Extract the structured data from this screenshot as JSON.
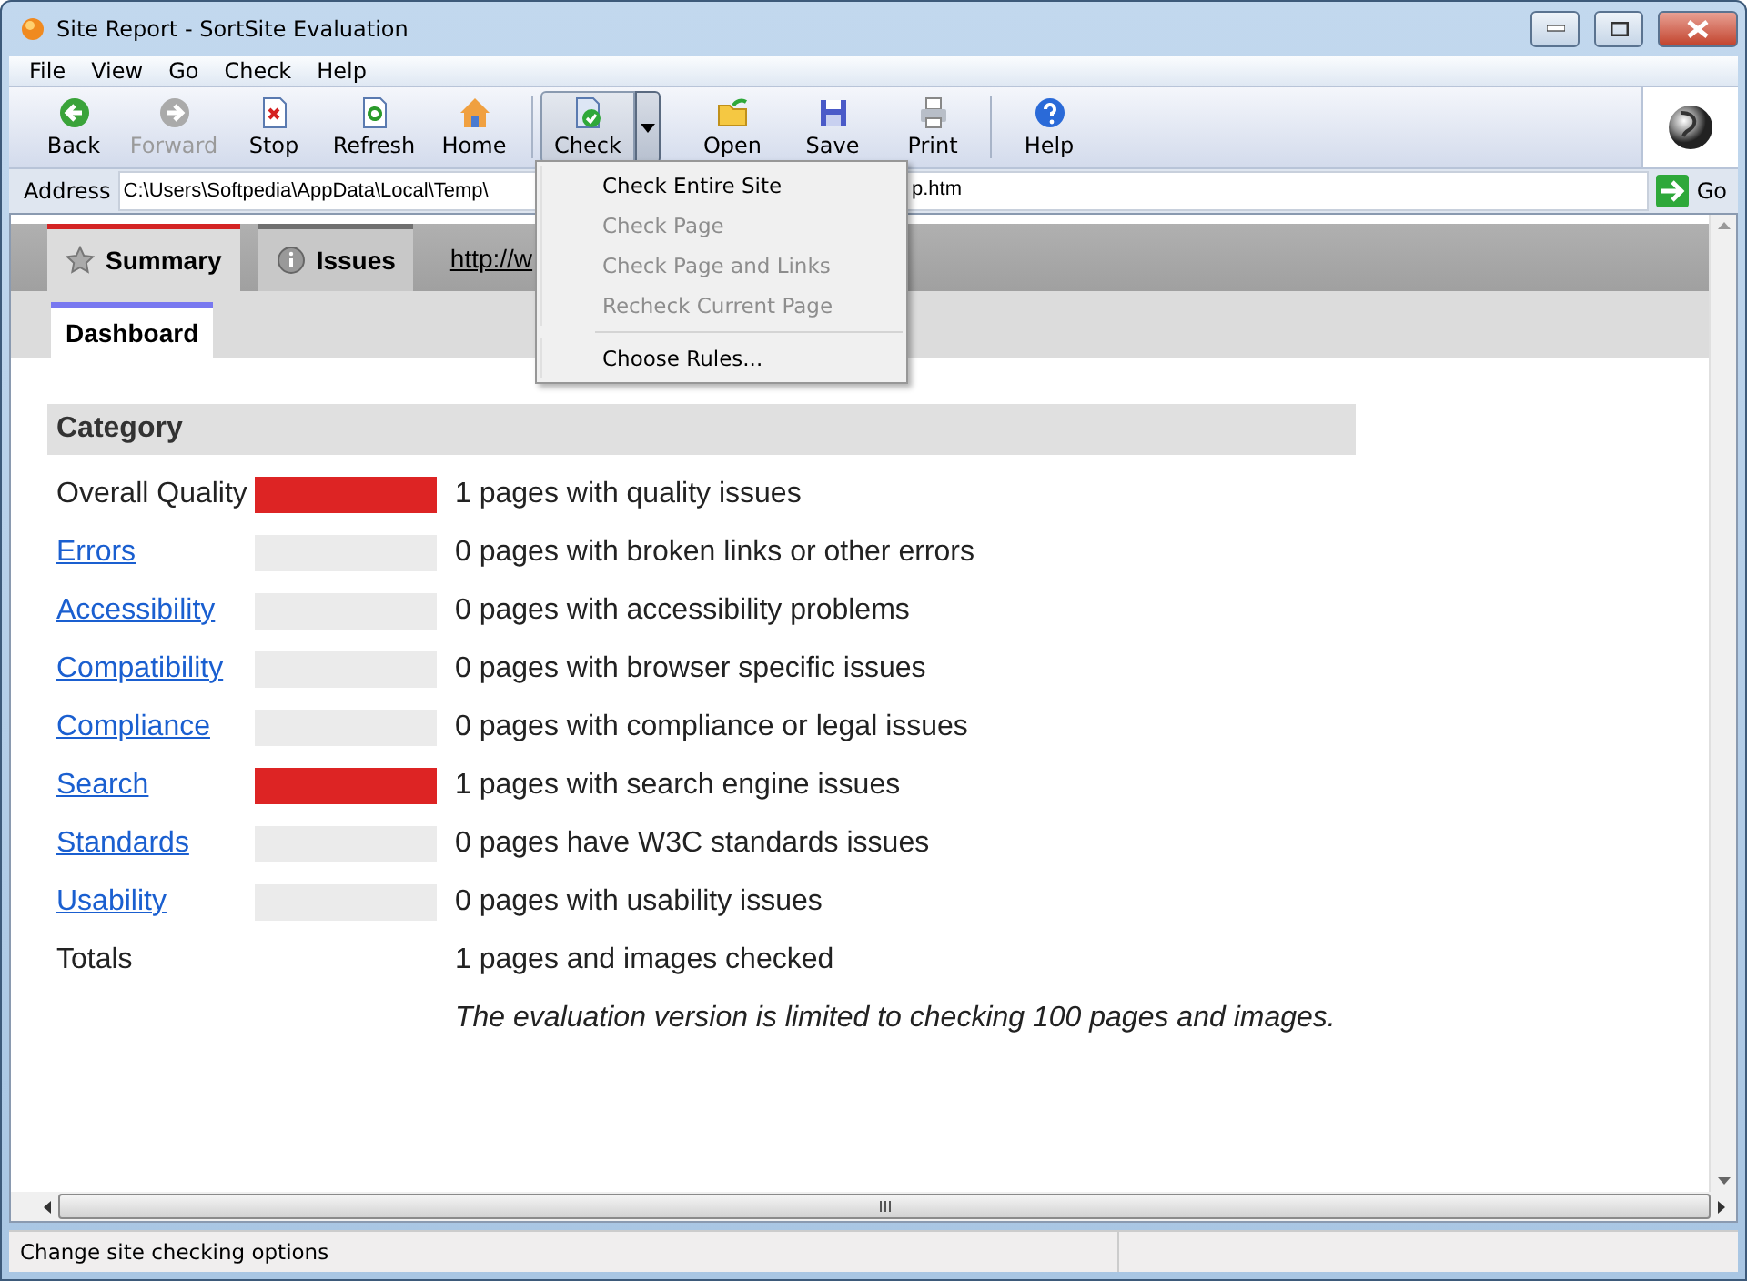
{
  "window": {
    "title": "Site Report - SortSite Evaluation"
  },
  "menu": [
    "File",
    "View",
    "Go",
    "Check",
    "Help"
  ],
  "toolbar": [
    {
      "kind": "back",
      "label": "Back",
      "disabled": false
    },
    {
      "kind": "forward",
      "label": "Forward",
      "disabled": true
    },
    {
      "kind": "stop",
      "label": "Stop",
      "disabled": false
    },
    {
      "kind": "refresh",
      "label": "Refresh",
      "disabled": false
    },
    {
      "kind": "home",
      "label": "Home",
      "disabled": false
    },
    {
      "kind": "check",
      "label": "Check",
      "disabled": false
    },
    {
      "kind": "open",
      "label": "Open",
      "disabled": false
    },
    {
      "kind": "save",
      "label": "Save",
      "disabled": false
    },
    {
      "kind": "print",
      "label": "Print",
      "disabled": false
    },
    {
      "kind": "help",
      "label": "Help",
      "disabled": false
    }
  ],
  "address": {
    "label": "Address",
    "value": "C:\\Users\\Softpedia\\AppData\\Local\\Temp\\",
    "value_tail": "p.htm",
    "go": "Go"
  },
  "check_menu": [
    {
      "label": "Check Entire Site",
      "disabled": false
    },
    {
      "label": "Check Page",
      "disabled": true
    },
    {
      "label": "Check Page and Links",
      "disabled": true
    },
    {
      "label": "Recheck Current Page",
      "disabled": true
    },
    {
      "label": "Choose Rules...",
      "disabled": false
    }
  ],
  "tabs": [
    {
      "label": "Summary",
      "selected": true
    },
    {
      "label": "Issues",
      "selected": false
    }
  ],
  "tab_link": "http://w",
  "subtabs": [
    {
      "label": "Dashboard",
      "selected": true
    }
  ],
  "report": {
    "header": "Category",
    "rows": [
      {
        "kind": "text",
        "label": "Overall Quality",
        "flagged": true,
        "description": "1 pages with quality issues"
      },
      {
        "kind": "link",
        "label": "Errors",
        "flagged": false,
        "description": "0 pages with broken links or other errors"
      },
      {
        "kind": "link",
        "label": "Accessibility",
        "flagged": false,
        "description": "0 pages with accessibility problems"
      },
      {
        "kind": "link",
        "label": "Compatibility",
        "flagged": false,
        "description": "0 pages with browser specific issues"
      },
      {
        "kind": "link",
        "label": "Compliance",
        "flagged": false,
        "description": "0 pages with compliance or legal issues"
      },
      {
        "kind": "link",
        "label": "Search",
        "flagged": true,
        "description": "1 pages with search engine issues"
      },
      {
        "kind": "link",
        "label": "Standards",
        "flagged": false,
        "description": "0 pages have W3C standards issues"
      },
      {
        "kind": "link",
        "label": "Usability",
        "flagged": false,
        "description": "0 pages with usability issues"
      }
    ],
    "totals": {
      "label": "Totals",
      "description": "1 pages and images checked"
    },
    "note": "The evaluation version is limited to checking 100 pages and images."
  },
  "status_bar": "Change site checking options"
}
